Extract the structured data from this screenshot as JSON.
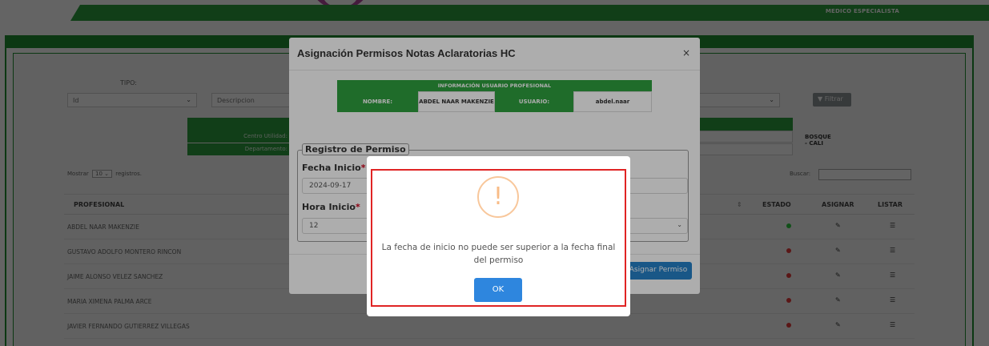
{
  "header": {
    "role": "MEDICO ESPECIALISTA"
  },
  "filters": {
    "tipo_label": "TIPO:",
    "tipo_value": "Id",
    "descripcion_value": "Descripcion",
    "filtrar_label": "Filtrar"
  },
  "info": {
    "centro_label": "Centro Utilidad:",
    "centro_value": "BOSQUE - CALI",
    "departamento_label": "Departamento:"
  },
  "table": {
    "show_prefix": "Mostrar",
    "page_size": "10",
    "show_suffix": "registros.",
    "search_label": "Buscar:",
    "columns": {
      "profesional": "PROFESIONAL",
      "estado": "ESTADO",
      "asignar": "ASIGNAR",
      "listar": "LISTAR"
    },
    "rows": [
      {
        "name": "ABDEL NAAR MAKENZIE",
        "status": "active"
      },
      {
        "name": "GUSTAVO ADOLFO MONTERO RINCON",
        "status": "inactive"
      },
      {
        "name": "JAIME ALONSO VELEZ SANCHEZ",
        "status": "inactive"
      },
      {
        "name": "MARIA XIMENA PALMA ARCE",
        "status": "inactive"
      },
      {
        "name": "JAVIER FERNANDO GUTIERREZ VILLEGAS",
        "status": "inactive"
      }
    ]
  },
  "modal": {
    "title": "Asignación Permisos Notas Aclaratorias HC",
    "close": "×",
    "user_info": {
      "header": "INFORMACIÓN USUARIO PROFESIONAL",
      "name_label": "NOMBRE:",
      "name_value": "ABDEL NAAR MAKENZIE",
      "user_label": "USUARIO:",
      "user_value": "abdel.naar"
    },
    "registro": {
      "legend": "Registro de Permiso",
      "fecha_inicio_label": "Fecha Inicio",
      "fecha_inicio_value": "2024-09-17",
      "hora_inicio_label": "Hora Inicio",
      "hora_inicio_value": "12",
      "required_mark": "*"
    },
    "submit_label": "Asignar Permiso"
  },
  "alert": {
    "icon": "!",
    "message": "La fecha de inicio no puede ser superior a la fecha final del permiso",
    "ok_label": "OK"
  },
  "colors": {
    "brand_green": "#2e9f3e",
    "primary_blue": "#2680c7",
    "alert_border": "#e02424",
    "warning_orange": "#f8bb86",
    "status_active": "#2ecc40",
    "status_inactive": "#e63a3a"
  }
}
